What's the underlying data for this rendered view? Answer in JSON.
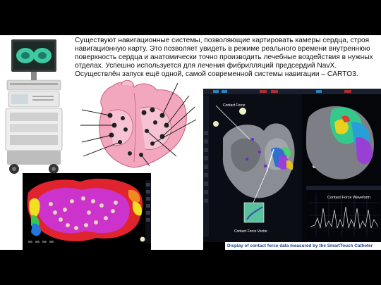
{
  "slide": {
    "paragraph": "Существуют навигационные системы, позволяющие картировать камеры сердца, строя навигационную карту. Это позволяет увидеть в режиме реального времени внутреннюю поверхность сердца и анатомически точно производить лечебные воздействия в нужных отделах. Успешно используется для лечения фибрилляций предсердий NavX. Осуществлён запуск ещё одной, самой современной системы навигации – CARTO3."
  },
  "contact_panel": {
    "label_force": "Contact Force",
    "label_vector": "Contact Force Vector",
    "waveform_title": "Contact Force Waveform",
    "caption": "Display of contact force data measured by the SmartTouch Catheter"
  },
  "colors": {
    "slide_background": "#000000",
    "content_background": "#ffffff",
    "caption_text": "#1d3f8f",
    "map_magenta": "#cc33cc"
  }
}
